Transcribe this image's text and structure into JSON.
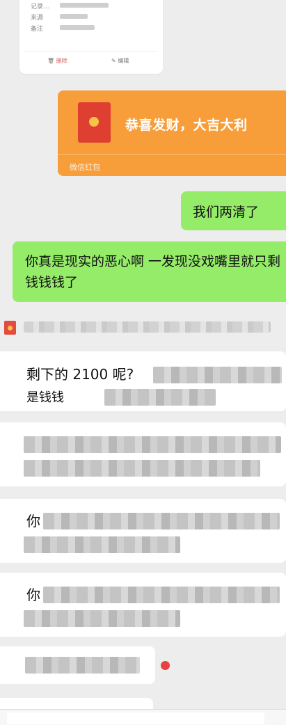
{
  "note_card": {
    "rows": [
      {
        "label": "记录..."
      },
      {
        "label": "来源"
      },
      {
        "label": "备注"
      }
    ],
    "delete_label": "删除",
    "edit_label": "编辑"
  },
  "red_packet": {
    "title": "恭喜发财，大吉大利",
    "footer": "微信红包"
  },
  "sent": [
    {
      "text": "我们两清了"
    },
    {
      "text": "你真是现实的恶心啊 一发现没戏嘴里就只剩钱钱钱了"
    }
  ],
  "received": [
    {
      "visible_text": "剩下的 2100 呢?"
    },
    {
      "visible_text": "是钱钱"
    },
    {
      "visible_text": "你"
    },
    {
      "visible_text": "你"
    }
  ],
  "colors": {
    "bg": "#ededed",
    "packet": "#f79e3a",
    "green_bubble": "#95ec69",
    "unread_dot": "#e64340"
  }
}
